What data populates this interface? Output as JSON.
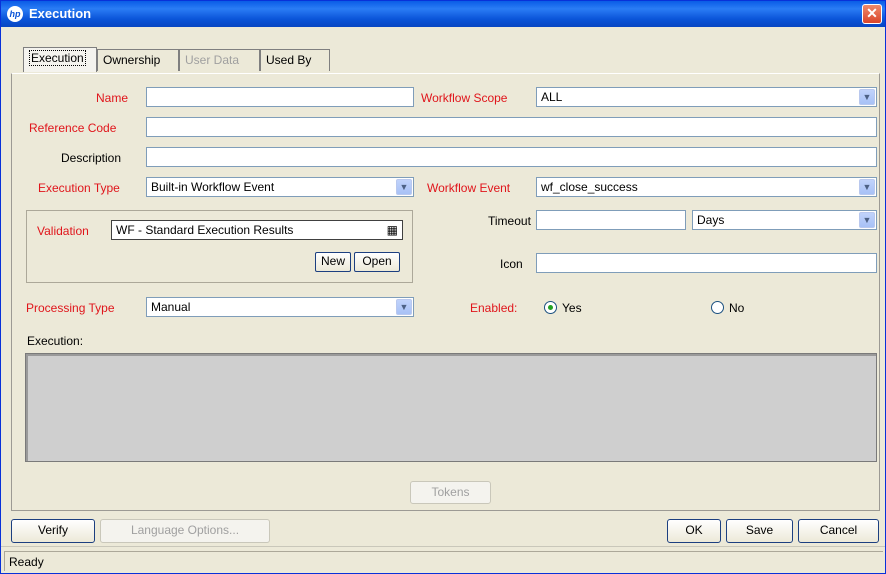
{
  "window": {
    "title": "Execution",
    "logo": "hp",
    "close": "✕"
  },
  "tabs": [
    {
      "label": "Execution",
      "active": true,
      "enabled": true
    },
    {
      "label": "Ownership",
      "active": false,
      "enabled": true
    },
    {
      "label": "User Data",
      "active": false,
      "enabled": false
    },
    {
      "label": "Used By",
      "active": false,
      "enabled": true
    }
  ],
  "form": {
    "name": {
      "label": "Name",
      "value": ""
    },
    "workflow_scope": {
      "label": "Workflow Scope",
      "value": "ALL"
    },
    "reference_code": {
      "label": "Reference Code",
      "value": ""
    },
    "description": {
      "label": "Description",
      "value": ""
    },
    "execution_type": {
      "label": "Execution Type",
      "value": "Built-in Workflow Event"
    },
    "workflow_event": {
      "label": "Workflow Event",
      "value": "wf_close_success"
    },
    "validation": {
      "label": "Validation",
      "value": "WF - Standard Execution Results",
      "new_label": "New",
      "open_label": "Open"
    },
    "timeout": {
      "label": "Timeout",
      "value": "",
      "unit": "Days"
    },
    "icon": {
      "label": "Icon",
      "value": ""
    },
    "processing_type": {
      "label": "Processing Type",
      "value": "Manual"
    },
    "enabled": {
      "label": "Enabled:",
      "yes_label": "Yes",
      "no_label": "No",
      "selected": "Yes"
    },
    "execution": {
      "label": "Execution:"
    },
    "tokens_label": "Tokens"
  },
  "footer": {
    "verify_label": "Verify",
    "language_options_label": "Language Options...",
    "ok_label": "OK",
    "save_label": "Save",
    "cancel_label": "Cancel"
  },
  "status": "Ready",
  "colors": {
    "required_label": "#e0151b",
    "titlebar": "#0a54d8"
  }
}
